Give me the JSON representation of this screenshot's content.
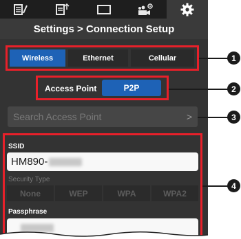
{
  "tabs": [
    {
      "icon": "clip-edit-icon"
    },
    {
      "icon": "clip-upload-icon"
    },
    {
      "icon": "monitor-icon"
    },
    {
      "icon": "camera-settings-icon"
    },
    {
      "icon": "gear-icon",
      "active": true
    }
  ],
  "header": {
    "title": "Settings > Connection Setup"
  },
  "connection_type": {
    "options": [
      "Wireless",
      "Ethernet",
      "Cellular"
    ],
    "selected": "Wireless"
  },
  "wireless_mode": {
    "label": "Access Point",
    "option": "P2P"
  },
  "search": {
    "placeholder": "Search Access Point",
    "arrow": ">"
  },
  "ssid": {
    "label": "SSID",
    "value": "HM890-"
  },
  "security": {
    "label": "Security Type",
    "options": [
      "None",
      "WEP",
      "WPA",
      "WPA2"
    ]
  },
  "passphrase": {
    "label": "Passphrase"
  },
  "callouts": [
    "1",
    "2",
    "3",
    "4"
  ],
  "colors": {
    "accent": "#1e62b6",
    "highlight": "#e8202a"
  }
}
